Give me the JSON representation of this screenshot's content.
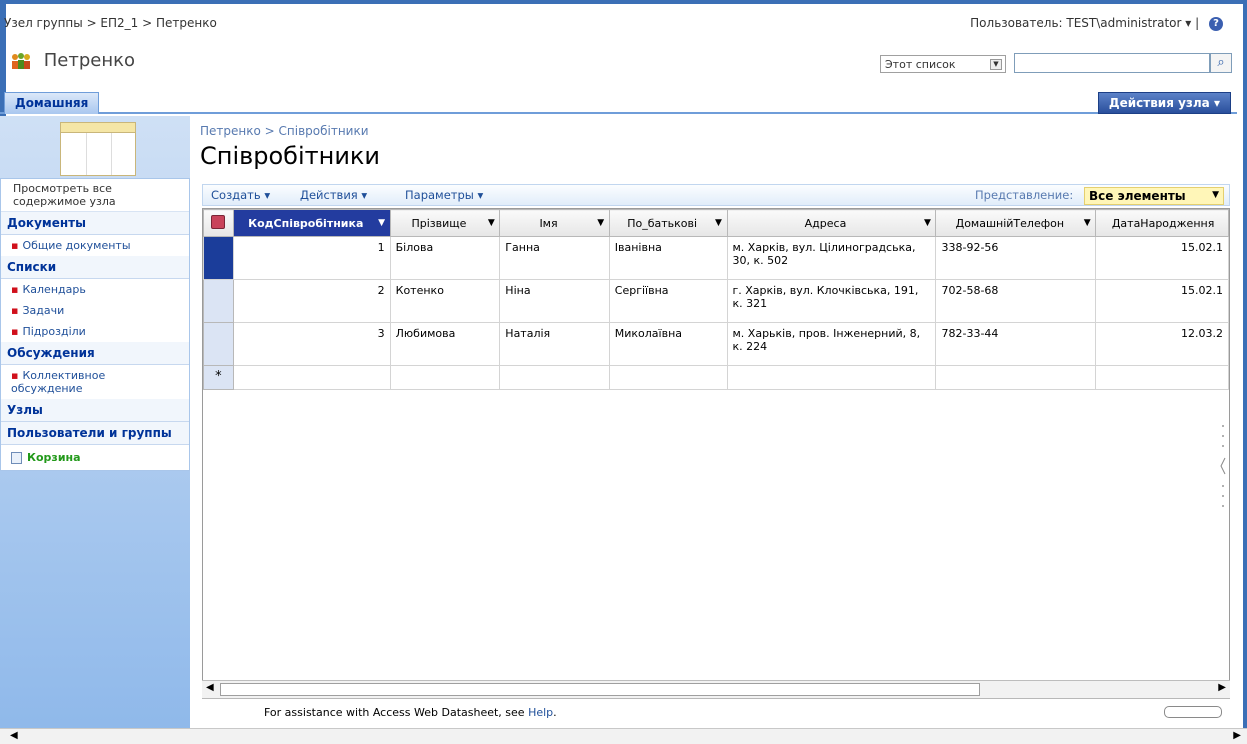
{
  "header": {
    "breadcrumb": "Узел группы > ЕП2_1 > Петренко",
    "user": "Пользователь: TEST\\administrator",
    "user_sep": "|",
    "help": "?",
    "site_title": "Петренко",
    "search_scope": "Этот список",
    "search_value": "",
    "search_icon": "magnifier-icon"
  },
  "nav": {
    "home_tab": "Домашняя",
    "site_actions": "Действия узла"
  },
  "leftnav": {
    "view_all": "Просмотреть все содержимое узла",
    "docs_head": "Документы",
    "docs_items": [
      "Общие документы"
    ],
    "lists_head": "Списки",
    "lists_items": [
      "Календарь",
      "Задачи",
      "Підрозділи"
    ],
    "disc_head": "Обсуждения",
    "disc_items": [
      "Коллективное обсуждение"
    ],
    "sites_head": "Узлы",
    "people_head": "Пользователи и группы",
    "recycle": "Корзина"
  },
  "page": {
    "breadcrumb": "Петренко > Співробітники",
    "title": "Співробітники"
  },
  "toolbar": {
    "create": "Создать",
    "actions": "Действия",
    "settings": "Параметры",
    "view_label": "Представление:",
    "view_value": "Все элементы"
  },
  "grid": {
    "columns": [
      "КодСпівробітника",
      "Прізвище",
      "Імя",
      "По_батькові",
      "Адреса",
      "ДомашнійТелефон",
      "ДатаНародження"
    ],
    "rows": [
      [
        "1",
        "Білова",
        "Ганна",
        "Іванівна",
        "м. Харків, вул. Цілиноградська, 30, к. 502",
        "338-92-56",
        "15.02.1"
      ],
      [
        "2",
        "Котенко",
        "Ніна",
        "Сергіївна",
        "г. Харків, вул. Клочківська, 191, к. 321",
        "702-58-68",
        "15.02.1"
      ],
      [
        "3",
        "Любимова",
        "Наталія",
        "Миколаївна",
        "м. Харьків, пров. Інженерний, 8, к. 224",
        "782-33-44",
        "12.03.2"
      ]
    ],
    "new_row_marker": "*"
  },
  "status": {
    "text": "For assistance with Access Web Datasheet, see",
    "link": "Help",
    "end": "."
  }
}
